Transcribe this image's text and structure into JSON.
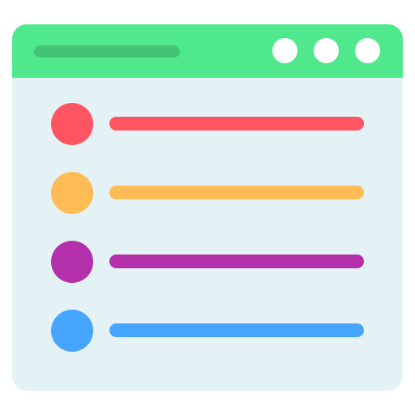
{
  "window": {
    "body_color": "#e4f2f6",
    "titlebar_color": "#50e88d",
    "address_bar_color": "#43c474",
    "controls": [
      {
        "icon": "window-control-circle",
        "color": "#ffffff"
      },
      {
        "icon": "window-control-circle",
        "color": "#ffffff"
      },
      {
        "icon": "window-control-circle",
        "color": "#ffffff"
      }
    ]
  },
  "list": {
    "items": [
      {
        "color": "#ff5461"
      },
      {
        "color": "#ffbb54"
      },
      {
        "color": "#b330aa"
      },
      {
        "color": "#46a5ff"
      }
    ]
  }
}
